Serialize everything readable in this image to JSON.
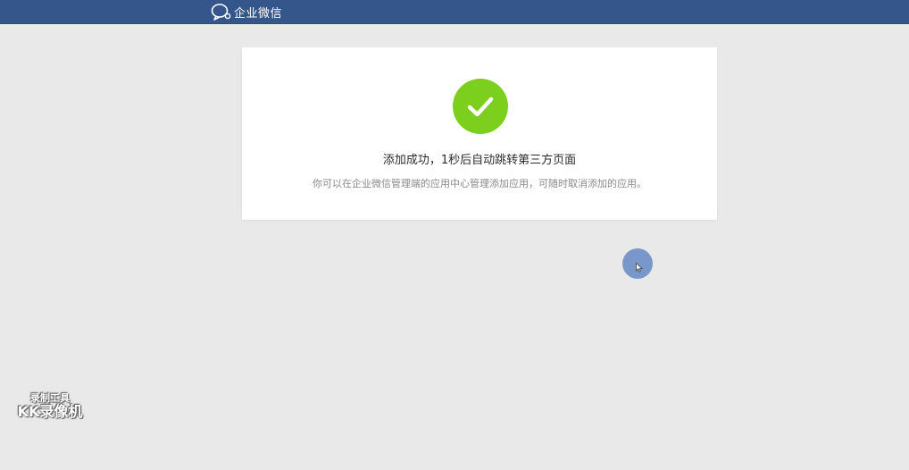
{
  "header": {
    "brand_name": "企业微信",
    "brand_icon": "chat-bubble-icon",
    "background_color": "#34568b"
  },
  "result": {
    "status_icon": "check-icon",
    "status_color": "#7ccf1d",
    "title": "添加成功，1秒后自动跳转第三方页面",
    "description": "你可以在企业微信管理端的应用中心管理添加应用，可随时取消添加的应用。"
  },
  "watermark": {
    "line1": "录制工具",
    "line2": "KK录像机"
  }
}
